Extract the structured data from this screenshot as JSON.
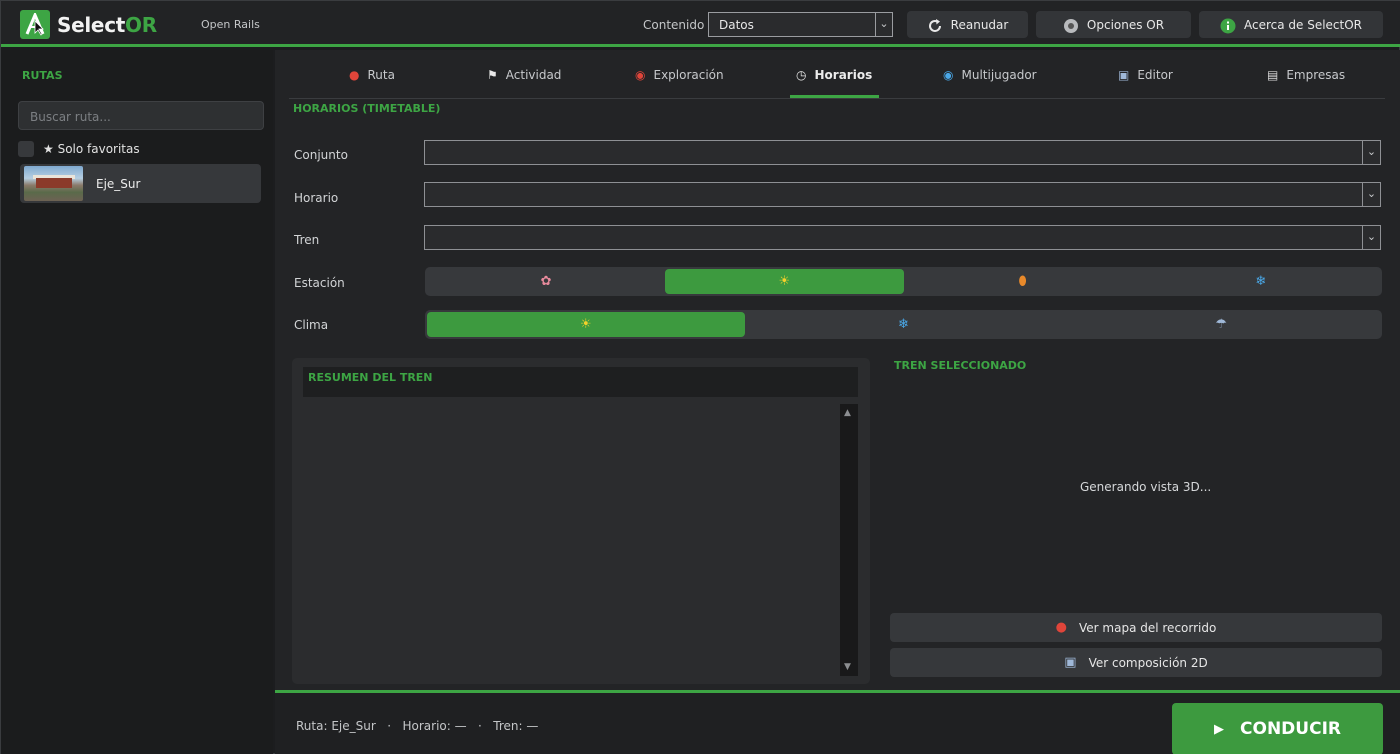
{
  "app": {
    "brand_main": "Select",
    "brand_accent": "OR",
    "subtitle": "Open Rails",
    "accent_color": "#3da544"
  },
  "header": {
    "content_label": "Contenido",
    "content_value": "Datos",
    "resume_label": "Reanudar",
    "options_label": "Opciones OR",
    "about_label": "Acerca de SelectOR",
    "icons": [
      "refresh-icon",
      "gear-icon",
      "info-icon"
    ]
  },
  "sidebar": {
    "title": "RUTAS",
    "search_placeholder": "Buscar ruta...",
    "favorites_label": "★  Solo favoritas",
    "routes": [
      {
        "name": "Eje_Sur"
      }
    ]
  },
  "tabs": [
    {
      "label": "Ruta",
      "icon": "pin-icon"
    },
    {
      "label": "Actividad",
      "icon": "checkered-flag-icon"
    },
    {
      "label": "Exploración",
      "icon": "compass-icon"
    },
    {
      "label": "Horarios",
      "icon": "clock-icon",
      "active": true
    },
    {
      "label": "Multijugador",
      "icon": "globe-icon"
    },
    {
      "label": "Editor",
      "icon": "train-icon"
    },
    {
      "label": "Empresas",
      "icon": "building-icon"
    }
  ],
  "timetable": {
    "section_title": "HORARIOS (TIMETABLE)",
    "conjunto_label": "Conjunto",
    "conjunto_value": "",
    "horario_label": "Horario",
    "horario_value": "",
    "tren_label": "Tren",
    "tren_value": "",
    "estacion_label": "Estación",
    "estacion_options": [
      {
        "icon": "flower-icon",
        "glyph": "✿",
        "color": "#e88a9c"
      },
      {
        "icon": "sun-icon",
        "glyph": "☀",
        "color": "#f6d12b",
        "selected": true
      },
      {
        "icon": "leaf-icon",
        "glyph": "⬮",
        "color": "#e8892a"
      },
      {
        "icon": "snowflake-icon",
        "glyph": "❄",
        "color": "#4aa8e8"
      }
    ],
    "clima_label": "Clima",
    "clima_options": [
      {
        "icon": "sun-icon",
        "glyph": "☀",
        "color": "#f6d12b",
        "selected": true
      },
      {
        "icon": "snowflake-icon",
        "glyph": "❄",
        "color": "#4aa8e8"
      },
      {
        "icon": "rain-cloud-icon",
        "glyph": "☂",
        "color": "#9fb8d8"
      }
    ]
  },
  "summary": {
    "title": "RESUMEN DEL TREN"
  },
  "selected": {
    "title": "TREN SELECCIONADO",
    "preview_status": "Generando vista 3D...",
    "map_button": "Ver mapa del recorrido",
    "composition_button": "Ver composición 2D"
  },
  "footer": {
    "status": "Ruta: Eje_Sur   ·   Horario: —   ·   Tren: —",
    "drive_label": "CONDUCIR"
  }
}
